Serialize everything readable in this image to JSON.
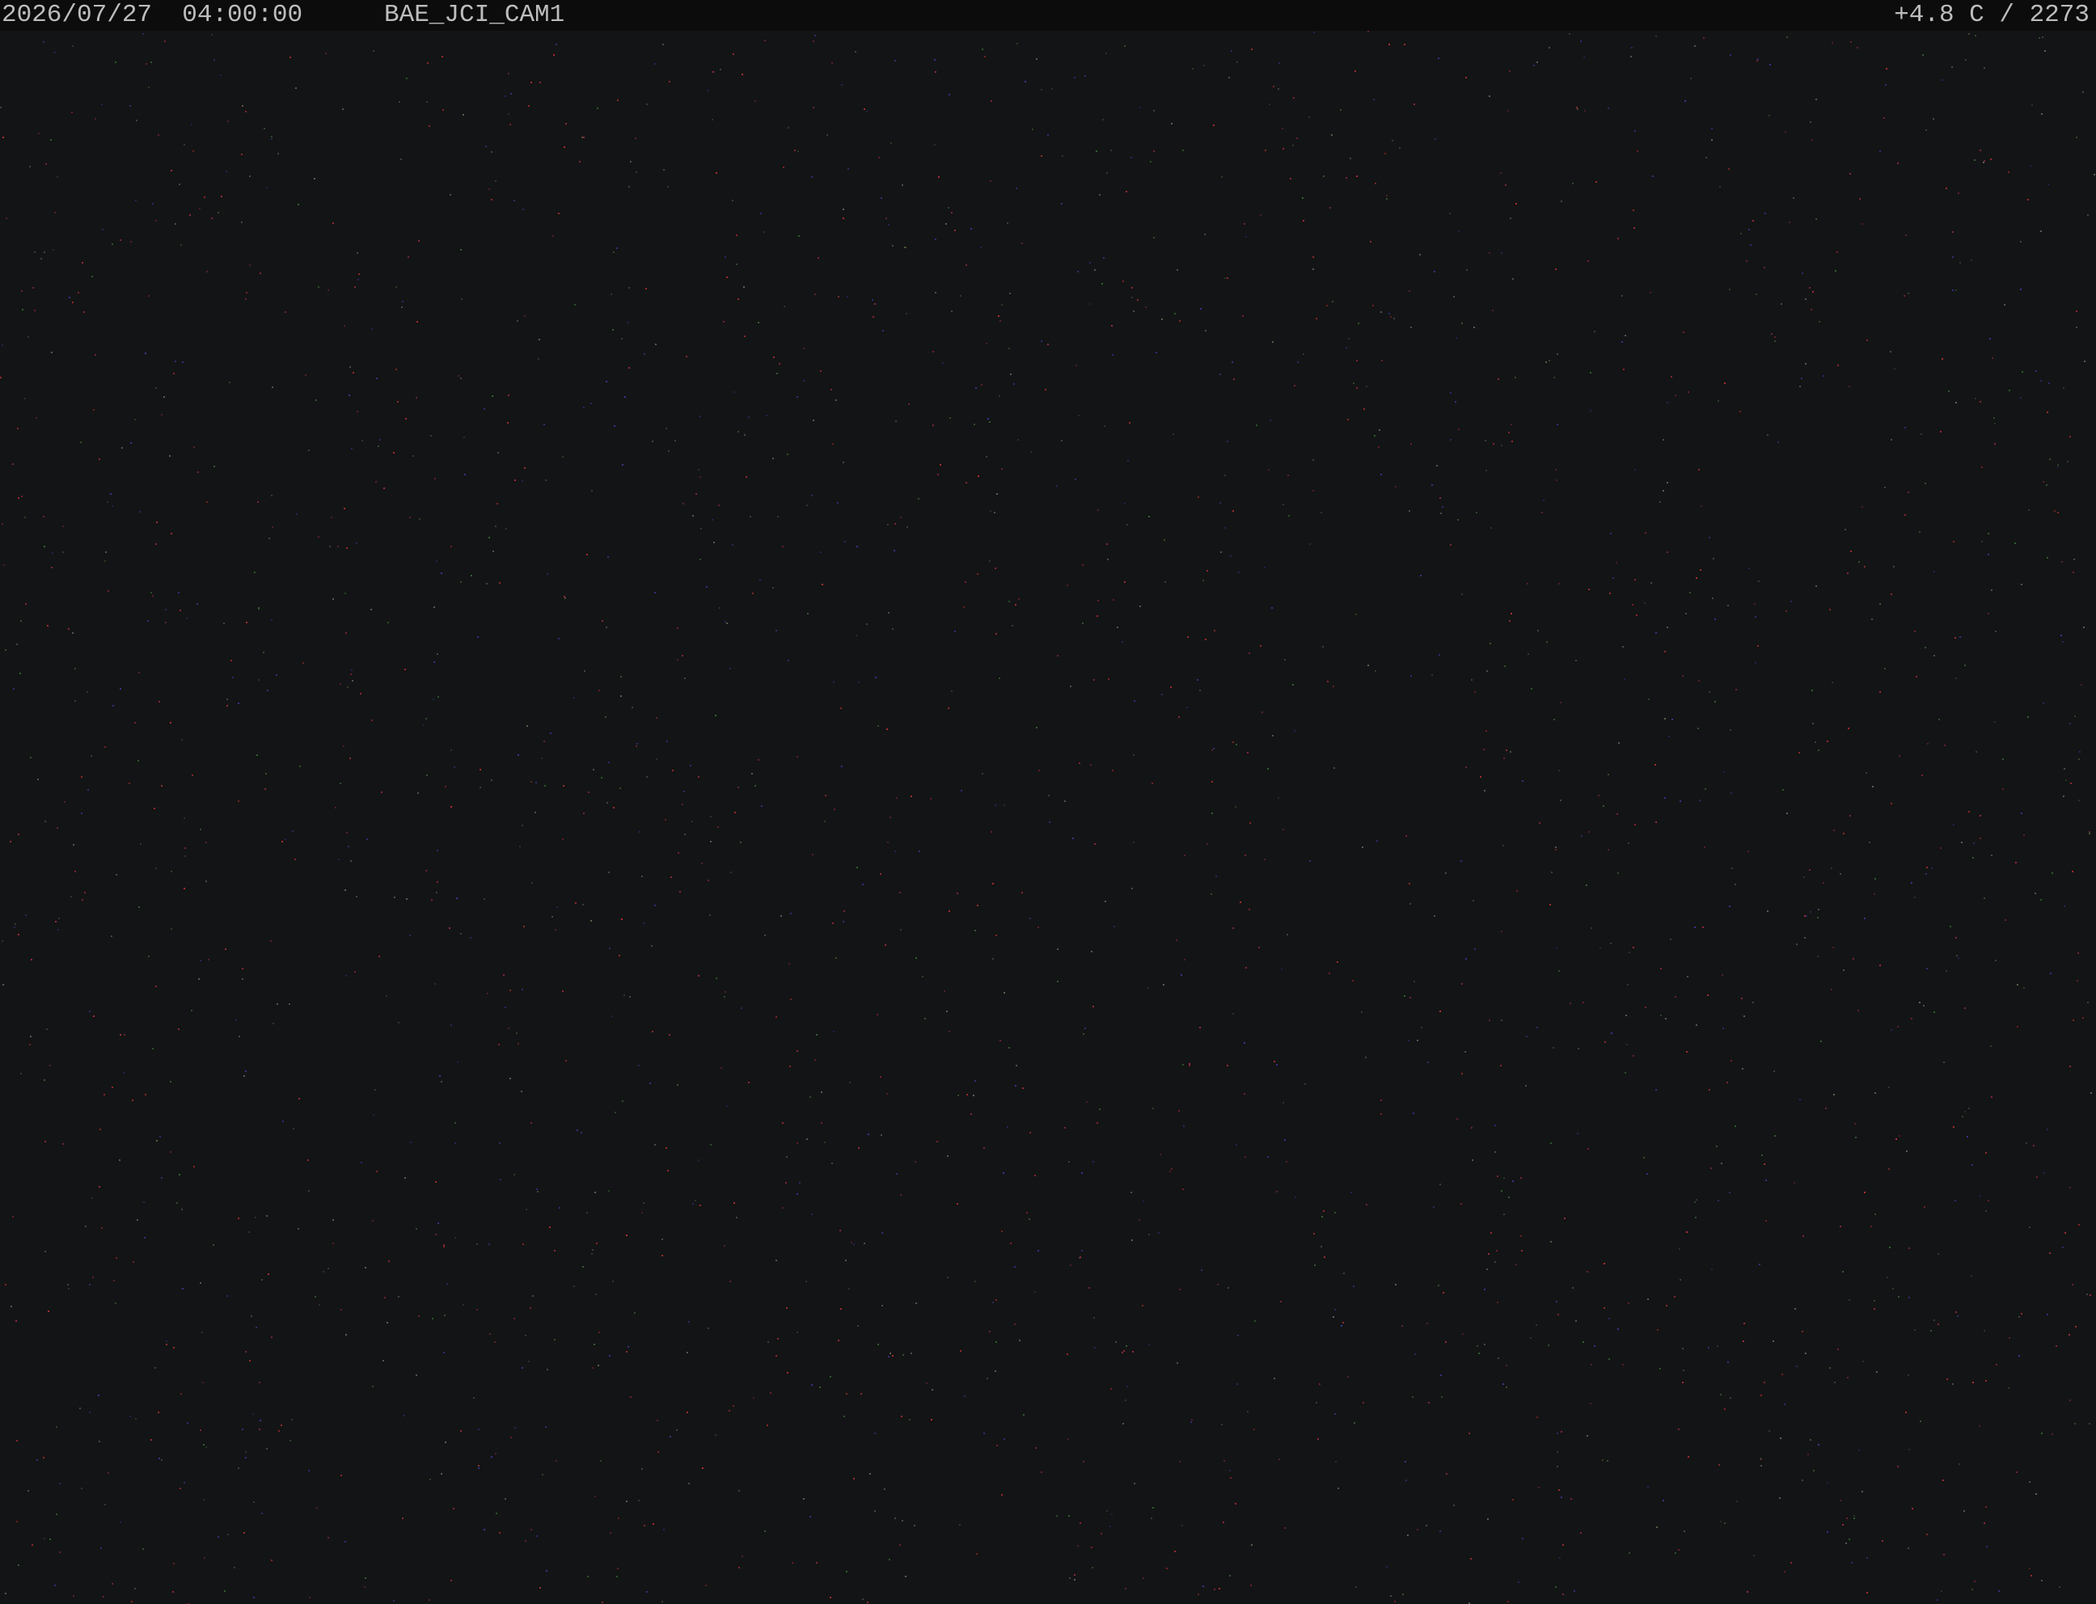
{
  "overlay": {
    "date": "2026/07/27",
    "time": "04:00:00",
    "camera_id": "BAE_JCI_CAM1",
    "temperature": "+4.8 C",
    "sequence": "2273"
  },
  "scene": {
    "description_icon": "night-sky-noise-image",
    "background_color": "#131415",
    "noise_colors": [
      "#c0303a",
      "#3a6a3a",
      "#3a3aa0",
      "#6a6a5a",
      "#a83040"
    ]
  }
}
